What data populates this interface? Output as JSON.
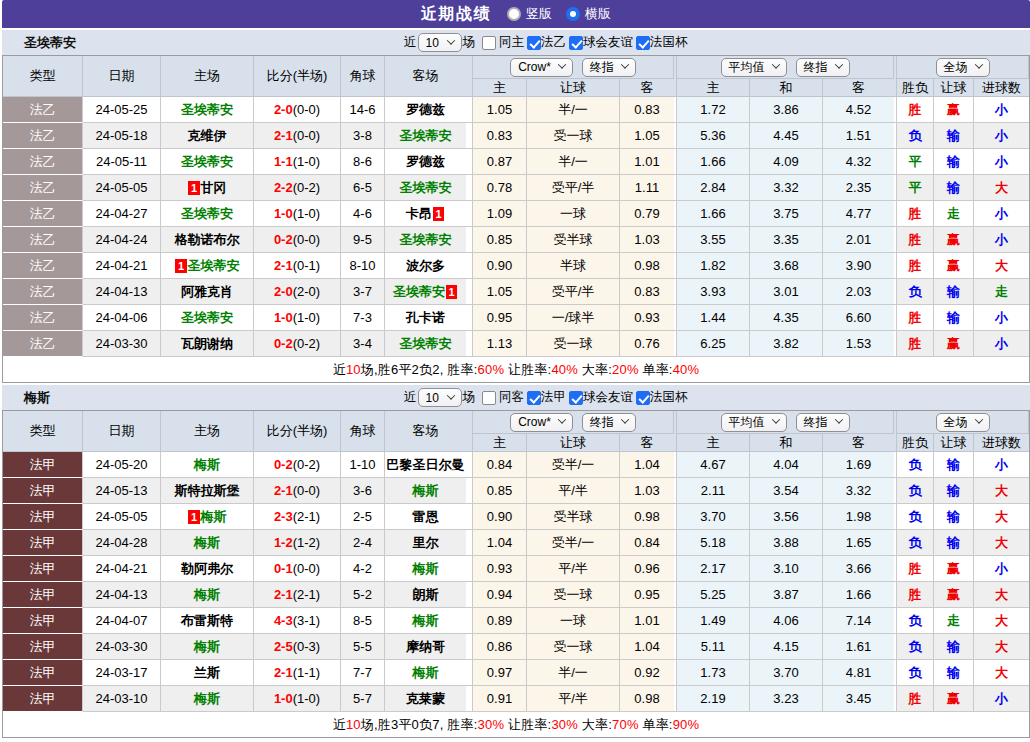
{
  "title_bar": {
    "title": "近期战绩",
    "view_options": [
      {
        "label": "竖版",
        "selected": false
      },
      {
        "label": "横版",
        "selected": true
      }
    ]
  },
  "columns": {
    "left": [
      "类型",
      "日期",
      "主场",
      "比分(半场)",
      "角球",
      "客场"
    ],
    "crow_sub": [
      "主",
      "让球",
      "客"
    ],
    "avg_sub": [
      "主",
      "和",
      "客"
    ],
    "result_sub": [
      "胜负",
      "让球",
      "进球数"
    ]
  },
  "colors": {
    "accent_purple": "#4e3f9b",
    "league_ligue2": "#a59898",
    "league_ligue1": "#6a3839",
    "team_green": "#008000",
    "score_red": "#ff0000",
    "checkbox_blue": "#1e6ef5",
    "result_map": {
      "胜": "#f00000",
      "平": "#008000",
      "负": "#0000f0",
      "赢": "#f00000",
      "走": "#008000",
      "输": "#0000f0",
      "大": "#f00000",
      "小": "#0000f0"
    }
  },
  "sections": [
    {
      "team": "圣埃蒂安",
      "league_color": "#a59898",
      "filter": {
        "recent_label": "近",
        "count": "10",
        "games_label": "场",
        "checkboxes": [
          {
            "label": "同主",
            "checked": false
          },
          {
            "label": "法乙",
            "checked": true
          },
          {
            "label": "球会友谊",
            "checked": true
          },
          {
            "label": "法国杯",
            "checked": true
          }
        ]
      },
      "controls": {
        "odds_source": "Crow*",
        "odds_stage": "终指",
        "avg_source": "平均值",
        "avg_stage": "终指",
        "scope": "全场"
      },
      "rows": [
        {
          "league": "法乙",
          "date": "24-05-25",
          "home": "圣埃蒂安",
          "home_card": "",
          "score": "2-0",
          "half": "(0-0)",
          "corner": "14-6",
          "away": "罗德兹",
          "away_card": "",
          "crow": [
            "1.05",
            "半/一",
            "0.83"
          ],
          "avg": [
            "1.72",
            "3.86",
            "4.52"
          ],
          "result": [
            "胜",
            "赢",
            "小"
          ]
        },
        {
          "league": "法乙",
          "date": "24-05-18",
          "home": "克维伊",
          "home_card": "",
          "score": "2-1",
          "half": "(0-0)",
          "corner": "3-8",
          "away": "圣埃蒂安",
          "away_card": "",
          "crow": [
            "0.83",
            "受一球",
            "1.05"
          ],
          "avg": [
            "5.36",
            "4.45",
            "1.51"
          ],
          "result": [
            "负",
            "输",
            "小"
          ]
        },
        {
          "league": "法乙",
          "date": "24-05-11",
          "home": "圣埃蒂安",
          "home_card": "",
          "score": "1-1",
          "half": "(1-0)",
          "corner": "8-6",
          "away": "罗德兹",
          "away_card": "",
          "crow": [
            "0.87",
            "半/一",
            "1.01"
          ],
          "avg": [
            "1.66",
            "4.09",
            "4.32"
          ],
          "result": [
            "平",
            "输",
            "小"
          ]
        },
        {
          "league": "法乙",
          "date": "24-05-05",
          "home": "甘冈",
          "home_card": "1",
          "score": "2-2",
          "half": "(0-2)",
          "corner": "6-5",
          "away": "圣埃蒂安",
          "away_card": "",
          "crow": [
            "0.78",
            "受平/半",
            "1.11"
          ],
          "avg": [
            "2.84",
            "3.32",
            "2.35"
          ],
          "result": [
            "平",
            "输",
            "大"
          ]
        },
        {
          "league": "法乙",
          "date": "24-04-27",
          "home": "圣埃蒂安",
          "home_card": "",
          "score": "1-0",
          "half": "(1-0)",
          "corner": "4-6",
          "away": "卡昂",
          "away_card": "1",
          "crow": [
            "1.09",
            "一球",
            "0.79"
          ],
          "avg": [
            "1.66",
            "3.75",
            "4.77"
          ],
          "result": [
            "胜",
            "走",
            "小"
          ]
        },
        {
          "league": "法乙",
          "date": "24-04-24",
          "home": "格勒诺布尔",
          "home_card": "",
          "score": "0-2",
          "half": "(0-0)",
          "corner": "9-5",
          "away": "圣埃蒂安",
          "away_card": "",
          "crow": [
            "0.85",
            "受半球",
            "1.03"
          ],
          "avg": [
            "3.55",
            "3.35",
            "2.01"
          ],
          "result": [
            "胜",
            "赢",
            "小"
          ]
        },
        {
          "league": "法乙",
          "date": "24-04-21",
          "home": "圣埃蒂安",
          "home_card": "1",
          "score": "2-1",
          "half": "(0-1)",
          "corner": "8-10",
          "away": "波尔多",
          "away_card": "",
          "crow": [
            "0.90",
            "半球",
            "0.98"
          ],
          "avg": [
            "1.82",
            "3.68",
            "3.90"
          ],
          "result": [
            "胜",
            "赢",
            "大"
          ]
        },
        {
          "league": "法乙",
          "date": "24-04-13",
          "home": "阿雅克肖",
          "home_card": "",
          "score": "2-0",
          "half": "(2-0)",
          "corner": "3-7",
          "away": "圣埃蒂安",
          "away_card": "1",
          "crow": [
            "1.05",
            "受平/半",
            "0.83"
          ],
          "avg": [
            "3.93",
            "3.01",
            "2.03"
          ],
          "result": [
            "负",
            "输",
            "走"
          ]
        },
        {
          "league": "法乙",
          "date": "24-04-06",
          "home": "圣埃蒂安",
          "home_card": "",
          "score": "1-0",
          "half": "(1-0)",
          "corner": "7-3",
          "away": "孔卡诺",
          "away_card": "",
          "crow": [
            "0.95",
            "一/球半",
            "0.93"
          ],
          "avg": [
            "1.44",
            "4.35",
            "6.60"
          ],
          "result": [
            "胜",
            "输",
            "小"
          ]
        },
        {
          "league": "法乙",
          "date": "24-03-30",
          "home": "瓦朗谢纳",
          "home_card": "",
          "score": "0-2",
          "half": "(0-2)",
          "corner": "3-4",
          "away": "圣埃蒂安",
          "away_card": "",
          "crow": [
            "1.13",
            "受一球",
            "0.76"
          ],
          "avg": [
            "6.25",
            "3.82",
            "1.53"
          ],
          "result": [
            "胜",
            "赢",
            "小"
          ]
        }
      ],
      "summary": [
        {
          "t": "近",
          "red": false
        },
        {
          "t": "10",
          "red": true
        },
        {
          "t": "场,胜6平2负2, 胜率:",
          "red": false
        },
        {
          "t": "60%",
          "red": true
        },
        {
          "t": " 让胜率:",
          "red": false
        },
        {
          "t": "40%",
          "red": true
        },
        {
          "t": " 大率:",
          "red": false
        },
        {
          "t": "20%",
          "red": true
        },
        {
          "t": " 单率:",
          "red": false
        },
        {
          "t": "40%",
          "red": true
        }
      ]
    },
    {
      "team": "梅斯",
      "league_color": "#6a3839",
      "filter": {
        "recent_label": "近",
        "count": "10",
        "games_label": "场",
        "checkboxes": [
          {
            "label": "同客",
            "checked": false
          },
          {
            "label": "法甲",
            "checked": true
          },
          {
            "label": "球会友谊",
            "checked": true
          },
          {
            "label": "法国杯",
            "checked": true
          }
        ]
      },
      "controls": {
        "odds_source": "Crow*",
        "odds_stage": "终指",
        "avg_source": "平均值",
        "avg_stage": "终指",
        "scope": "全场"
      },
      "rows": [
        {
          "league": "法甲",
          "date": "24-05-20",
          "home": "梅斯",
          "home_card": "",
          "score": "0-2",
          "half": "(0-2)",
          "corner": "1-10",
          "away": "巴黎圣日尔曼",
          "away_card": "",
          "crow": [
            "0.84",
            "受半/一",
            "1.04"
          ],
          "avg": [
            "4.67",
            "4.04",
            "1.69"
          ],
          "result": [
            "负",
            "输",
            "小"
          ]
        },
        {
          "league": "法甲",
          "date": "24-05-13",
          "home": "斯特拉斯堡",
          "home_card": "",
          "score": "2-1",
          "half": "(0-0)",
          "corner": "3-6",
          "away": "梅斯",
          "away_card": "",
          "crow": [
            "0.85",
            "平/半",
            "1.03"
          ],
          "avg": [
            "2.11",
            "3.54",
            "3.32"
          ],
          "result": [
            "负",
            "输",
            "大"
          ]
        },
        {
          "league": "法甲",
          "date": "24-05-05",
          "home": "梅斯",
          "home_card": "1",
          "score": "2-3",
          "half": "(2-1)",
          "corner": "2-5",
          "away": "雷恩",
          "away_card": "",
          "crow": [
            "0.90",
            "受半球",
            "0.98"
          ],
          "avg": [
            "3.70",
            "3.56",
            "1.98"
          ],
          "result": [
            "负",
            "输",
            "大"
          ]
        },
        {
          "league": "法甲",
          "date": "24-04-28",
          "home": "梅斯",
          "home_card": "",
          "score": "1-2",
          "half": "(1-2)",
          "corner": "2-4",
          "away": "里尔",
          "away_card": "",
          "crow": [
            "1.04",
            "受半/一",
            "0.84"
          ],
          "avg": [
            "5.18",
            "3.88",
            "1.65"
          ],
          "result": [
            "负",
            "输",
            "大"
          ]
        },
        {
          "league": "法甲",
          "date": "24-04-21",
          "home": "勒阿弗尔",
          "home_card": "",
          "score": "0-1",
          "half": "(0-0)",
          "corner": "4-2",
          "away": "梅斯",
          "away_card": "",
          "crow": [
            "0.93",
            "平/半",
            "0.96"
          ],
          "avg": [
            "2.17",
            "3.10",
            "3.66"
          ],
          "result": [
            "胜",
            "赢",
            "小"
          ]
        },
        {
          "league": "法甲",
          "date": "24-04-13",
          "home": "梅斯",
          "home_card": "",
          "score": "2-1",
          "half": "(2-1)",
          "corner": "5-2",
          "away": "朗斯",
          "away_card": "",
          "crow": [
            "0.94",
            "受一球",
            "0.95"
          ],
          "avg": [
            "5.25",
            "3.87",
            "1.66"
          ],
          "result": [
            "胜",
            "赢",
            "大"
          ]
        },
        {
          "league": "法甲",
          "date": "24-04-07",
          "home": "布雷斯特",
          "home_card": "",
          "score": "4-3",
          "half": "(3-1)",
          "corner": "8-5",
          "away": "梅斯",
          "away_card": "",
          "crow": [
            "0.89",
            "一球",
            "1.01"
          ],
          "avg": [
            "1.49",
            "4.06",
            "7.14"
          ],
          "result": [
            "负",
            "走",
            "大"
          ]
        },
        {
          "league": "法甲",
          "date": "24-03-30",
          "home": "梅斯",
          "home_card": "",
          "score": "2-5",
          "half": "(0-3)",
          "corner": "5-5",
          "away": "摩纳哥",
          "away_card": "",
          "crow": [
            "0.86",
            "受一球",
            "1.04"
          ],
          "avg": [
            "5.11",
            "4.15",
            "1.61"
          ],
          "result": [
            "负",
            "输",
            "大"
          ]
        },
        {
          "league": "法甲",
          "date": "24-03-17",
          "home": "兰斯",
          "home_card": "",
          "score": "2-1",
          "half": "(1-1)",
          "corner": "7-7",
          "away": "梅斯",
          "away_card": "",
          "crow": [
            "0.97",
            "半/一",
            "0.92"
          ],
          "avg": [
            "1.73",
            "3.70",
            "4.81"
          ],
          "result": [
            "负",
            "输",
            "大"
          ]
        },
        {
          "league": "法甲",
          "date": "24-03-10",
          "home": "梅斯",
          "home_card": "",
          "score": "1-0",
          "half": "(1-0)",
          "corner": "5-7",
          "away": "克莱蒙",
          "away_card": "",
          "crow": [
            "0.91",
            "平/半",
            "0.98"
          ],
          "avg": [
            "2.19",
            "3.23",
            "3.45"
          ],
          "result": [
            "胜",
            "赢",
            "小"
          ]
        }
      ],
      "summary": [
        {
          "t": "近",
          "red": false
        },
        {
          "t": "10",
          "red": true
        },
        {
          "t": "场,胜3平0负7, 胜率:",
          "red": false
        },
        {
          "t": "30%",
          "red": true
        },
        {
          "t": " 让胜率:",
          "red": false
        },
        {
          "t": "30%",
          "red": true
        },
        {
          "t": " 大率:",
          "red": false
        },
        {
          "t": "70%",
          "red": true
        },
        {
          "t": " 单率:",
          "red": false
        },
        {
          "t": "90%",
          "red": true
        }
      ]
    }
  ]
}
